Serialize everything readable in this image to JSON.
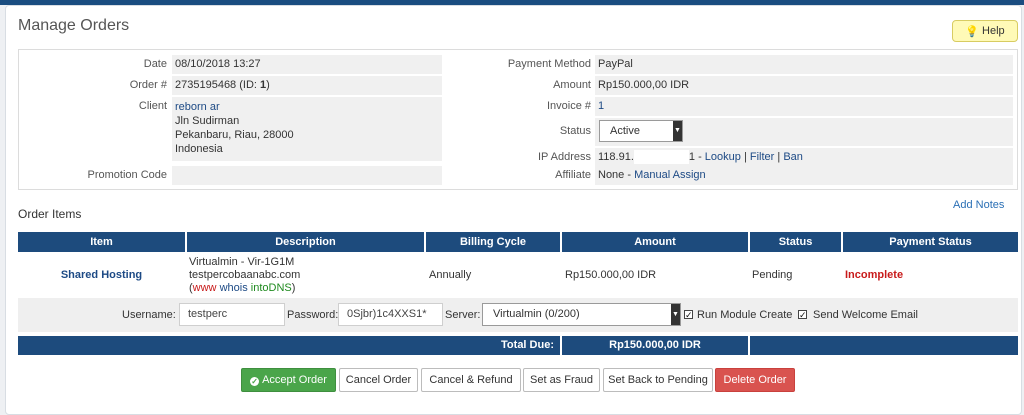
{
  "page": {
    "title": "Manage Orders",
    "help_label": "Help"
  },
  "order": {
    "date_label": "Date",
    "date": "08/10/2018 13:27",
    "order_no_label": "Order #",
    "order_no": "2735195468",
    "order_id_prefix": "(ID: ",
    "order_id": "1",
    "order_id_suffix": ")",
    "client_label": "Client",
    "client_name": "reborn ar",
    "client_address": [
      "Jln Sudirman",
      "Pekanbaru, Riau, 28000",
      "Indonesia"
    ],
    "promo_label": "Promotion Code",
    "promo_value": "",
    "payment_method_label": "Payment Method",
    "payment_method": "PayPal",
    "amount_label": "Amount",
    "amount": "Rp150.000,00 IDR",
    "invoice_label": "Invoice #",
    "invoice": "1",
    "status_label": "Status",
    "status": "Active",
    "ip_label": "IP Address",
    "ip_prefix": "118.91.",
    "ip_suffix": "1 - ",
    "ip_lookup": "Lookup",
    "ip_filter": "Filter",
    "ip_ban": "Ban",
    "sep": "|",
    "affiliate_label": "Affiliate",
    "affiliate_value": "None - ",
    "affiliate_link": "Manual Assign"
  },
  "items": {
    "section_title": "Order Items",
    "add_notes": "Add Notes",
    "columns": [
      "Item",
      "Description",
      "Billing Cycle",
      "Amount",
      "Status",
      "Payment Status"
    ],
    "rows": [
      {
        "item": "Shared Hosting",
        "desc_line1": "Virtualmin - Vir-1G1M",
        "desc_line2": "testpercobaanabc.com",
        "desc_open": "(",
        "desc_www": "www",
        "desc_whois": "whois",
        "desc_intodns": "intoDNS",
        "desc_close": ")",
        "billing_cycle": "Annually",
        "amount": "Rp150.000,00 IDR",
        "status": "Pending",
        "payment_status": "Incomplete"
      }
    ]
  },
  "module": {
    "username_label": "Username:",
    "username": "testperc",
    "password_label": "Password:",
    "password": "0Sjbr)1c4XXS1*",
    "server_label": "Server:",
    "server": "Virtualmin (0/200)",
    "run_module_label": "Run Module Create",
    "run_module_checked": true,
    "welcome_label": "Send Welcome Email",
    "welcome_checked": true
  },
  "totals": {
    "label": "Total Due:",
    "value": "Rp150.000,00 IDR"
  },
  "actions": {
    "accept": "Accept Order",
    "cancel": "Cancel Order",
    "cancel_refund": "Cancel & Refund",
    "fraud": "Set as Fraud",
    "pending": "Set Back to Pending",
    "delete": "Delete Order"
  },
  "colors": {
    "header": "#1d4b7d",
    "accept": "#4aa54a",
    "delete": "#d9534f",
    "incomplete": "#c81a1a"
  }
}
